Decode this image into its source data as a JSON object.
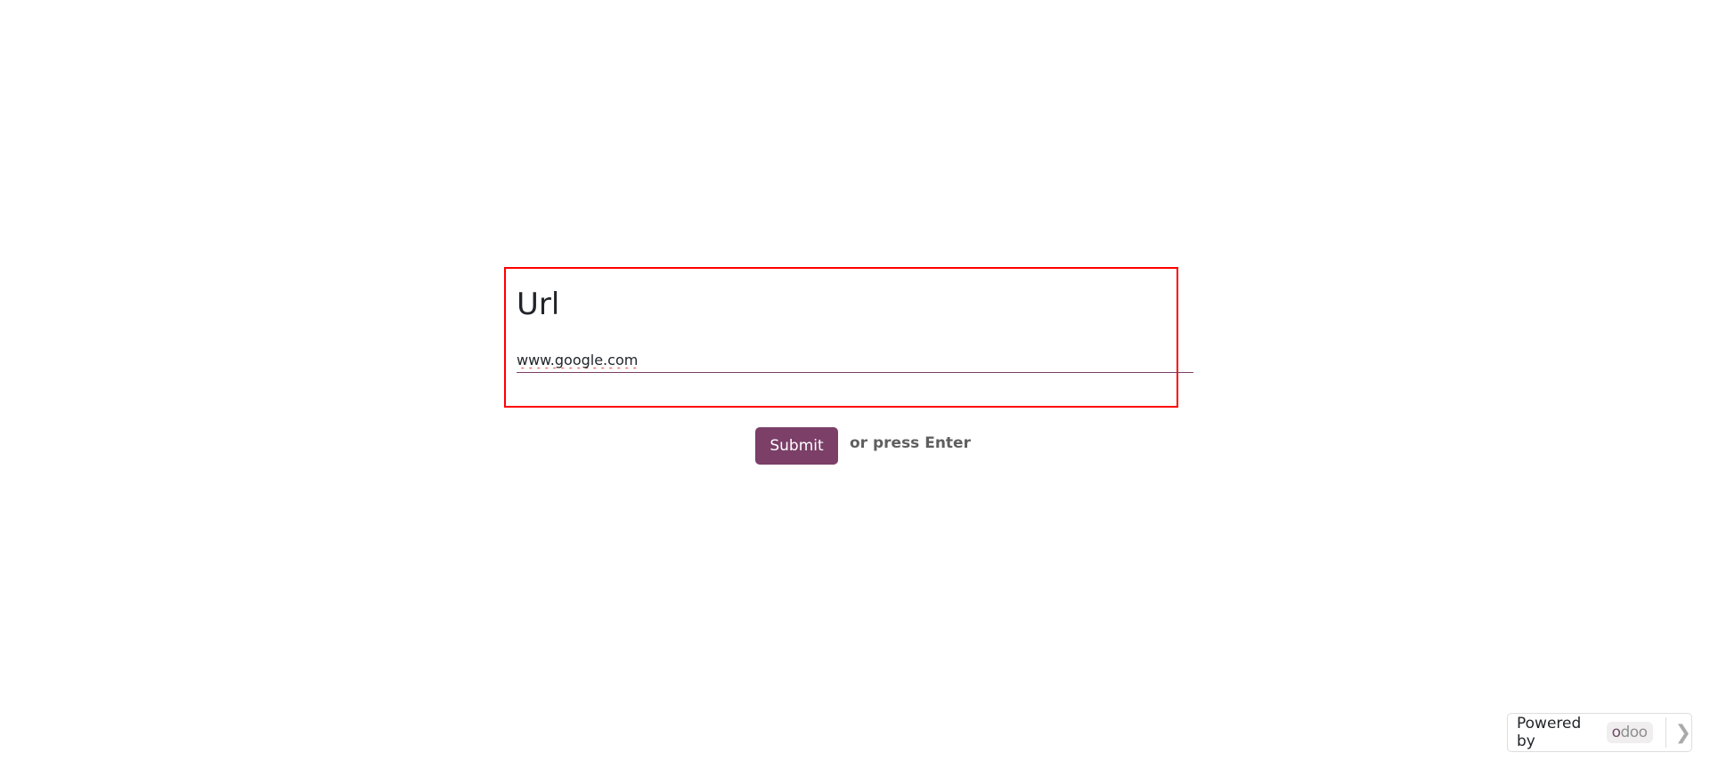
{
  "form": {
    "title": "Url",
    "url_value": "www.google.com",
    "submit_label": "Submit",
    "hint": "or press Enter"
  },
  "footer": {
    "powered_by": "Powered by",
    "brand_first": "o",
    "brand_rest": "doo"
  },
  "colors": {
    "accent": "#7b3f68",
    "highlight": "#ff0000"
  }
}
